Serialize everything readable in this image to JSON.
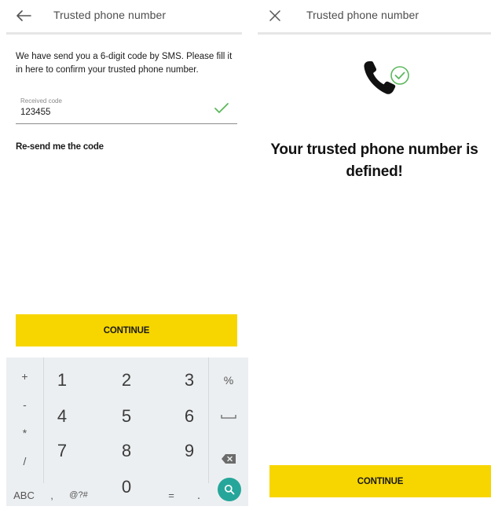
{
  "left_screen": {
    "appbar": {
      "title": "Trusted phone number",
      "nav_icon": "arrow-left-icon"
    },
    "instruction": "We have send you a 6-digit code by SMS. Please fill it in here to confirm your trusted phone number.",
    "code_field": {
      "label": "Received code",
      "value": "123455",
      "status_icon": "check-icon"
    },
    "resend_label": "Re-send me the code",
    "continue_label": "CONTINUE"
  },
  "keypad": {
    "symbols": {
      "plus": "+",
      "minus": "-",
      "times": "*",
      "slash": "/",
      "percent": "%"
    },
    "digits": [
      "1",
      "2",
      "3",
      "4",
      "5",
      "6",
      "7",
      "8",
      "9",
      "0"
    ],
    "bottom": {
      "abc": "ABC",
      "comma": ",",
      "alt": "@?#",
      "equals": "=",
      "dot": "."
    },
    "icons": {
      "space": "space-bar-icon",
      "backspace": "backspace-icon",
      "search": "search-icon"
    }
  },
  "right_screen": {
    "appbar": {
      "title": "Trusted phone number",
      "nav_icon": "close-icon"
    },
    "success_icon": "phone-check-icon",
    "success_message": "Your trusted phone number is defined!",
    "continue_label": "CONTINUE"
  },
  "colors": {
    "accent_yellow": "#f7d600",
    "check_green": "#5cb85c",
    "keypad_bg": "#eceff1",
    "search_key": "#26a69a"
  }
}
